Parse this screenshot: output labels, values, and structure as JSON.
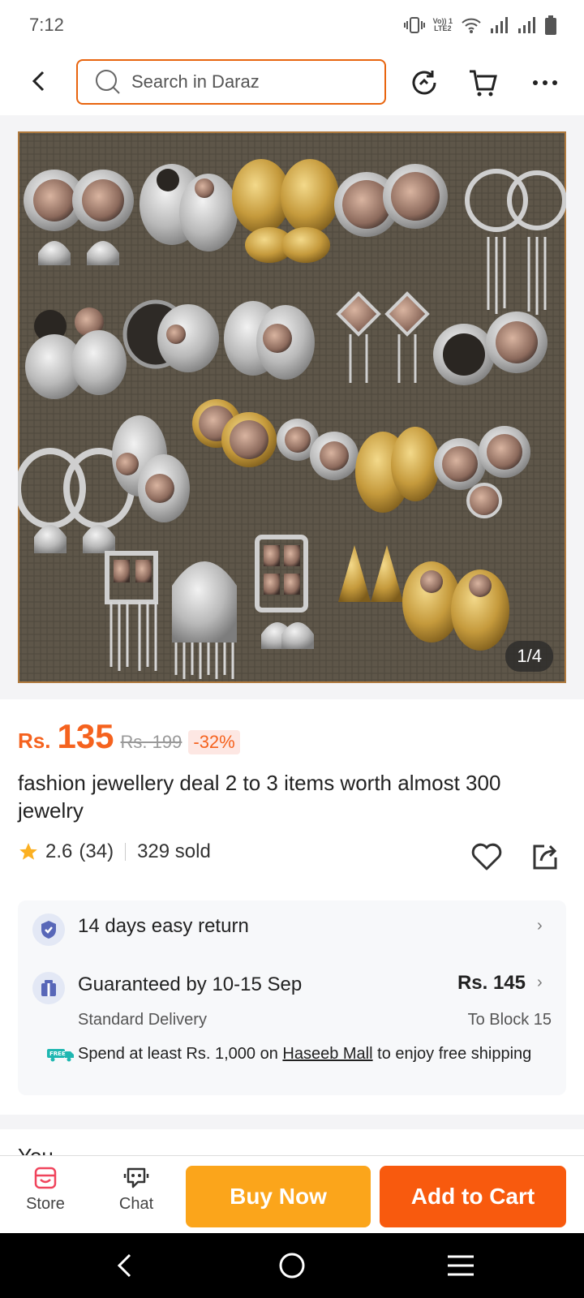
{
  "status_bar": {
    "time": "7:12",
    "volte_label": "VoLTE2"
  },
  "header": {
    "search_placeholder": "Search in Daraz"
  },
  "gallery": {
    "counter": "1/4"
  },
  "price": {
    "currency": "Rs.",
    "current": "135",
    "original": "Rs. 199",
    "discount": "-32%"
  },
  "product": {
    "title": "fashion jewellery deal 2 to 3 items worth almost 300 jewelry"
  },
  "rating": {
    "score": "2.6",
    "count": "(34)",
    "sold": "329 sold"
  },
  "service": {
    "return_text": "14 days easy return",
    "delivery_title": "Guaranteed by 10-15 Sep",
    "delivery_type": "Standard Delivery",
    "delivery_price": "Rs. 145",
    "delivery_to": "To Block 15",
    "free_badge": "FREE",
    "free_shipping_pre": "Spend at least Rs. 1,000 on ",
    "free_shipping_store": "Haseeb Mall",
    "free_shipping_post": " to enjoy free shipping"
  },
  "next_section_partial": "You",
  "bottom_bar": {
    "store_label": "Store",
    "chat_label": "Chat",
    "buy_now": "Buy Now",
    "add_to_cart": "Add to Cart"
  },
  "colors": {
    "accent": "#f85a0e",
    "buy_now": "#fba51b",
    "price": "#f5621e"
  }
}
